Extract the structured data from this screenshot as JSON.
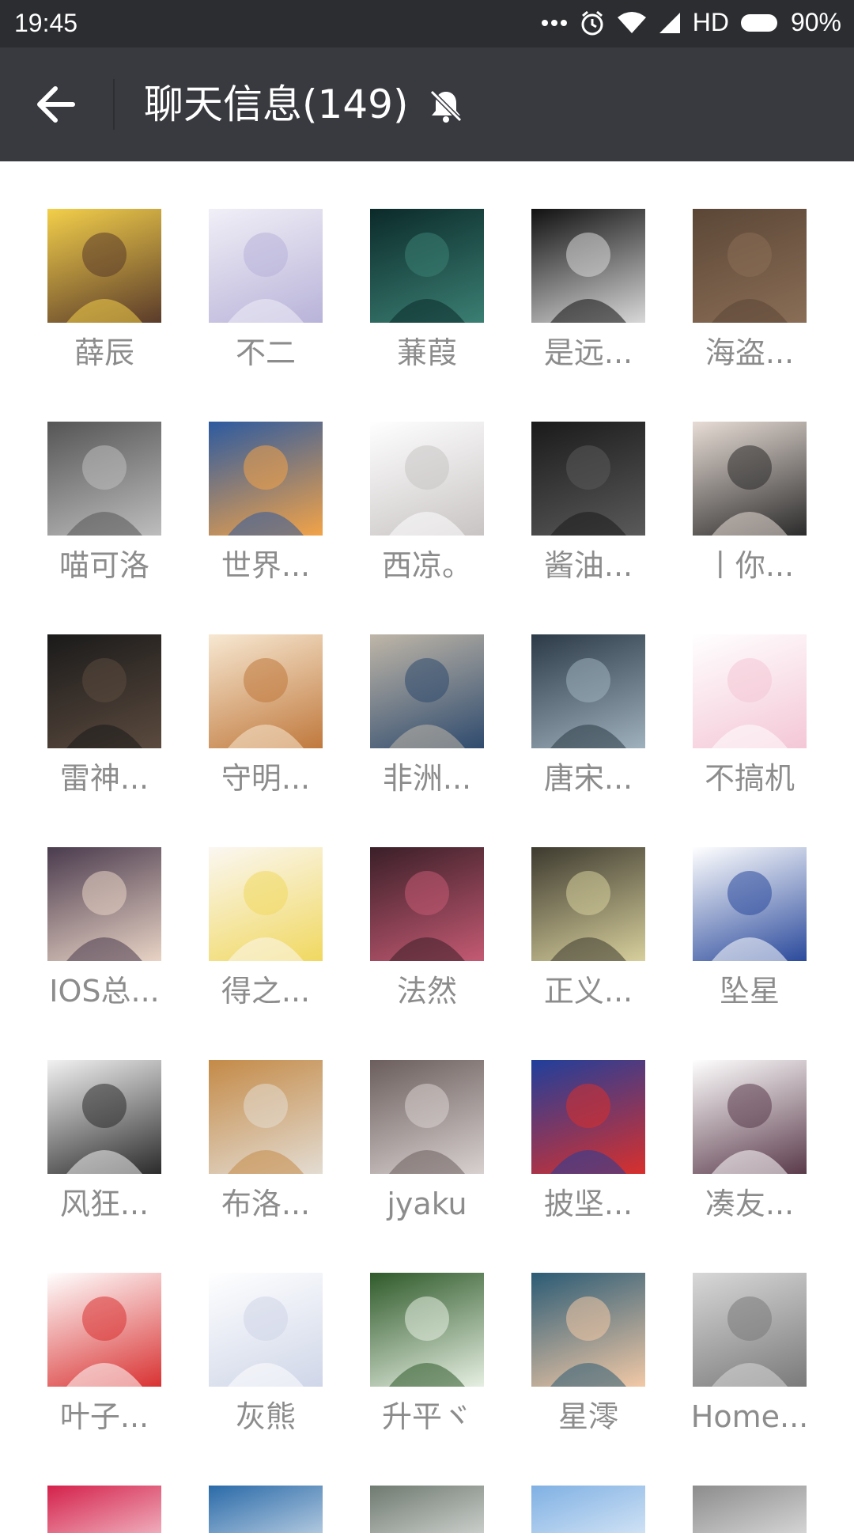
{
  "status_bar": {
    "time": "19:45",
    "network": "HD",
    "battery": "90%"
  },
  "header": {
    "title": "聊天信息(149)",
    "back_icon": "arrow-left-icon",
    "mute_icon": "bell-off-icon"
  },
  "members": [
    {
      "name": "薛辰",
      "colors": [
        "#f3cf4a",
        "#5a3b2a"
      ]
    },
    {
      "name": "不二",
      "colors": [
        "#f1eff7",
        "#b8b3d9"
      ]
    },
    {
      "name": "蒹葭",
      "colors": [
        "#0b2a2a",
        "#3b7f73"
      ]
    },
    {
      "name": "是远...",
      "colors": [
        "#111111",
        "#d8d8d8"
      ]
    },
    {
      "name": "海盗...",
      "colors": [
        "#5b4636",
        "#8a6e56"
      ]
    },
    {
      "name": "喵可洛",
      "colors": [
        "#555555",
        "#bdbdbd"
      ]
    },
    {
      "name": "世界...",
      "colors": [
        "#2c5aa0",
        "#f2a348"
      ]
    },
    {
      "name": "西凉。",
      "colors": [
        "#ffffff",
        "#c9c4c4"
      ]
    },
    {
      "name": "酱油...",
      "colors": [
        "#1a1a1a",
        "#5a5a5a"
      ]
    },
    {
      "name": "丨你...",
      "colors": [
        "#e8ddd6",
        "#2b2b2b"
      ]
    },
    {
      "name": "雷神...",
      "colors": [
        "#1a1a1a",
        "#5b4a3e"
      ]
    },
    {
      "name": "守明...",
      "colors": [
        "#f7e8d2",
        "#c0793d"
      ]
    },
    {
      "name": "非洲...",
      "colors": [
        "#bfb6a8",
        "#2f4b6e"
      ]
    },
    {
      "name": "唐宋...",
      "colors": [
        "#2b3a46",
        "#9fb1bd"
      ]
    },
    {
      "name": "不搞机",
      "colors": [
        "#ffffff",
        "#f4c7d6"
      ]
    },
    {
      "name": "IOS总...",
      "colors": [
        "#4a3b4e",
        "#e9d3c5"
      ]
    },
    {
      "name": "得之...",
      "colors": [
        "#fbf7f2",
        "#f0d860"
      ]
    },
    {
      "name": "法然",
      "colors": [
        "#3a1f28",
        "#c45a73"
      ]
    },
    {
      "name": "正义...",
      "colors": [
        "#3d3a2f",
        "#d7cf9c"
      ]
    },
    {
      "name": "坠星",
      "colors": [
        "#ffffff",
        "#2b4a9c"
      ]
    },
    {
      "name": "风狂...",
      "colors": [
        "#f2f2f2",
        "#2b2b2b"
      ]
    },
    {
      "name": "布洛...",
      "colors": [
        "#c48a47",
        "#e3dcd2"
      ]
    },
    {
      "name": "jyaku",
      "colors": [
        "#6b5e5c",
        "#d8d1d0"
      ]
    },
    {
      "name": "披坚...",
      "colors": [
        "#1f3f9c",
        "#d8302c"
      ]
    },
    {
      "name": "凑友...",
      "colors": [
        "#ffffff",
        "#5a3a4a"
      ]
    },
    {
      "name": "叶子...",
      "colors": [
        "#ffffff",
        "#d93232"
      ]
    },
    {
      "name": "灰熊",
      "colors": [
        "#ffffff",
        "#cfd6e8"
      ]
    },
    {
      "name": "升平ヾ",
      "colors": [
        "#2f5a2a",
        "#e6efe2"
      ]
    },
    {
      "name": "星澪",
      "colors": [
        "#2b5b75",
        "#f2c9a6"
      ]
    },
    {
      "name": "Home...",
      "colors": [
        "#d8d8d8",
        "#7a7a7a"
      ]
    }
  ],
  "partial_row_colors": [
    "#d4214a",
    "#2a6aa8",
    "#6f7a70",
    "#7fb0e3",
    "#8c8c8c"
  ]
}
